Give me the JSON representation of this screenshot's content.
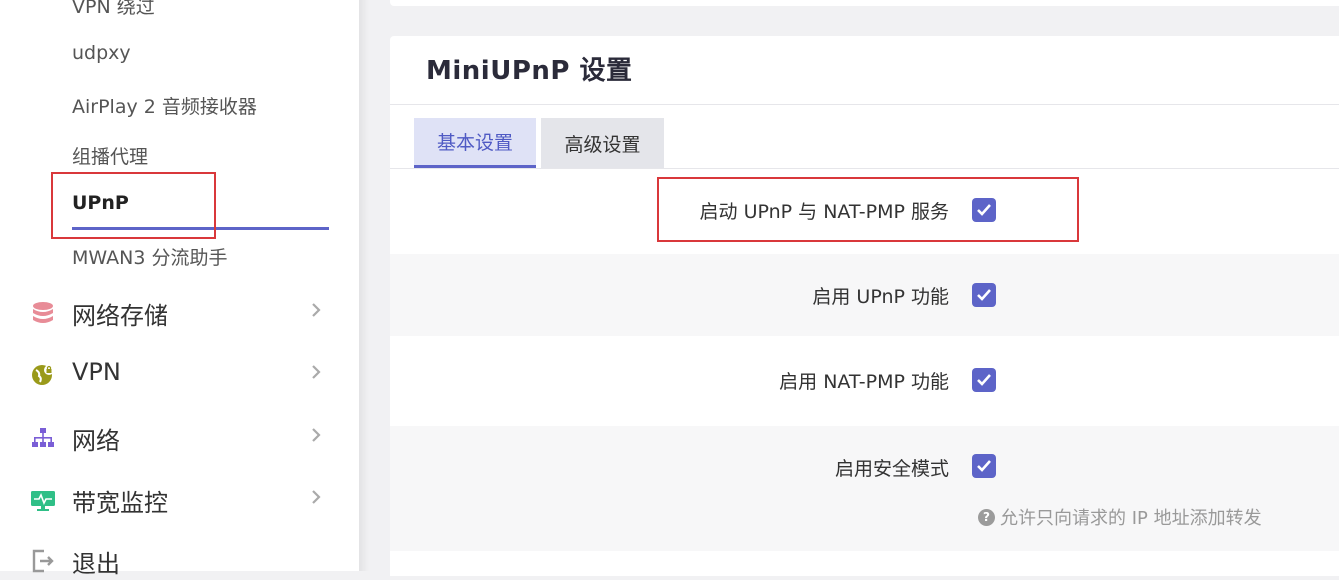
{
  "sidebar": {
    "sub_items": [
      {
        "label": "VPN 绕过"
      },
      {
        "label": "udpxy"
      },
      {
        "label": "AirPlay 2 音频接收器"
      },
      {
        "label": "组播代理"
      },
      {
        "label": "UPnP",
        "active": true
      },
      {
        "label": "MWAN3 分流助手"
      }
    ],
    "menu_items": [
      {
        "label": "网络存储",
        "icon": "database-icon"
      },
      {
        "label": "VPN",
        "icon": "vpn-globe-icon"
      },
      {
        "label": "网络",
        "icon": "network-icon"
      },
      {
        "label": "带宽监控",
        "icon": "bandwidth-monitor-icon"
      },
      {
        "label": "退出",
        "icon": "logout-icon"
      }
    ]
  },
  "main": {
    "title": "MiniUPnP 设置",
    "tabs": [
      {
        "label": "基本设置",
        "active": true
      },
      {
        "label": "高级设置",
        "active": false
      }
    ],
    "settings": [
      {
        "label": "启动 UPnP 与 NAT-PMP 服务",
        "checked": true
      },
      {
        "label": "启用 UPnP 功能",
        "checked": true
      },
      {
        "label": "启用 NAT-PMP 功能",
        "checked": true
      },
      {
        "label": "启用安全模式",
        "checked": true,
        "hint": "允许只向请求的 IP 地址添加转发"
      }
    ]
  },
  "colors": {
    "accent": "#5d64c8",
    "highlight_box": "#d9383b",
    "tab_active_bg": "#dfe2f6"
  }
}
